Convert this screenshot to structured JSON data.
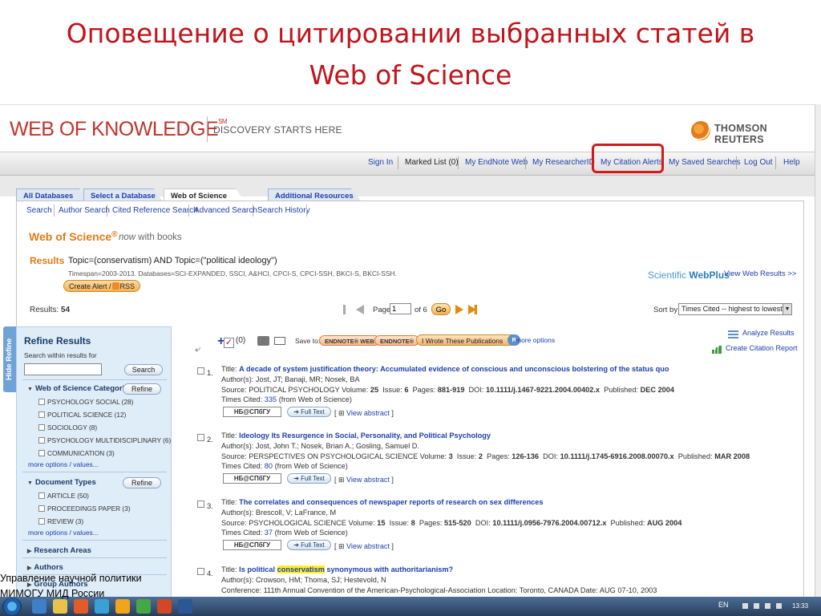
{
  "slide": {
    "title_line1": "Оповещение о цитировании выбранных статей в",
    "title_line2": "Web of Science",
    "footer_line1": "Управление научной политики",
    "footer_line2": "МИМОГУ МИД России"
  },
  "header": {
    "logo": "WEB OF KNOWLEDGE",
    "logo_sm": "SM",
    "tagline": "DISCOVERY STARTS HERE",
    "publisher": "THOMSON REUTERS"
  },
  "toplinks": [
    "Sign In",
    "Marked List (0)",
    "My EndNote Web",
    "My ResearcherID",
    "My Citation Alerts",
    "My Saved Searches",
    "Log Out",
    "Help"
  ],
  "db_tabs": [
    "All Databases",
    "Select a Database",
    "Web of Science",
    "Additional Resources"
  ],
  "subnav": [
    "Search",
    "Author Search",
    "Cited Reference Search",
    "Advanced Search",
    "Search History"
  ],
  "wos": {
    "title": "Web of Science",
    "reg": "®",
    "subtitle_now": "now",
    "subtitle_rest": " with books"
  },
  "results": {
    "label": "Results",
    "query": "Topic=(conservatism) AND Topic=(\"political ideology\")",
    "timespan": "Timespan=2003-2013. Databases=SCI-EXPANDED, SSCI, A&HCI, CPCI-S, CPCI-SSH, BKCI-S, BKCI-SSH.",
    "create_alert": "Create Alert /",
    "rss": "RSS",
    "webplus_a": "Scientific",
    "webplus_b": "WebPlus",
    "view_web": "View Web Results >>",
    "count_label": "Results:",
    "count": "54",
    "page_label": "Page",
    "page_value": "1",
    "page_of": "of 6",
    "go": "Go",
    "sort_label": "Sort by:",
    "sort_value": "Times Cited -- highest to lowest"
  },
  "refine": {
    "hide": "Hide Refine",
    "title": "Refine Results",
    "search_label": "Search within results for",
    "search_btn": "Search",
    "refine_btn": "Refine",
    "cat_title": "Web of Science Categories",
    "categories": [
      "PSYCHOLOGY SOCIAL (28)",
      "POLITICAL SCIENCE (12)",
      "SOCIOLOGY (8)",
      "PSYCHOLOGY MULTIDISCIPLINARY (6)",
      "COMMUNICATION (3)"
    ],
    "more": "more options / values...",
    "doc_title": "Document Types",
    "doc_types": [
      "ARTICLE (50)",
      "PROCEEDINGS PAPER (3)",
      "REVIEW (3)"
    ],
    "closed_sections": [
      "Research Areas",
      "Authors",
      "Group Authors"
    ]
  },
  "actions": {
    "count": "(0)",
    "save_to": "Save to:",
    "endnote_web": "ENDNOTE® WEB",
    "endnote": "ENDNOTE®",
    "iwrote": "I Wrote These Publications",
    "rid": "R",
    "more": "more options",
    "analyze": "Analyze Results",
    "ccr": "Create Citation Report"
  },
  "records": [
    {
      "num": "1.",
      "title_label": "Title:",
      "title_pre": "A decade of system justification theory: Accumulated evidence of conscious and unconscious bolstering of the status quo",
      "title_hl": "",
      "title_post": "",
      "authors": "Author(s): Jost, JT; Banaji, MR; Nosek, BA",
      "source_label": "Source: POLITICAL PSYCHOLOGY  Volume:",
      "volume": "25",
      "issue_label": "Issue:",
      "issue": "6",
      "pages_label": "Pages:",
      "pages": "881-919",
      "doi_label": "DOI:",
      "doi": "10.1111/j.1467-9221.2004.00402.x",
      "pub_label": "Published:",
      "published": "DEC 2004",
      "cited_label": "Times Cited:",
      "cited": "335",
      "cited_src": "(from Web of Science)",
      "lib": "НБ@СПбГУ",
      "fulltext": "➔ Full Text",
      "view_abstract": "View abstract"
    },
    {
      "num": "2.",
      "title_label": "Title:",
      "title_pre": "Ideology Its Resurgence in Social, Personality, and Political Psychology",
      "title_hl": "",
      "title_post": "",
      "authors": "Author(s): Jost, John T.; Nosek, Brian A.; Gosling, Samuel D.",
      "source_label": "Source: PERSPECTIVES ON PSYCHOLOGICAL SCIENCE  Volume:",
      "volume": "3",
      "issue_label": "Issue:",
      "issue": "2",
      "pages_label": "Pages:",
      "pages": "126-136",
      "doi_label": "DOI:",
      "doi": "10.1111/j.1745-6916.2008.00070.x",
      "pub_label": "Published:",
      "published": "MAR 2008",
      "cited_label": "Times Cited:",
      "cited": "80",
      "cited_src": "(from Web of Science)",
      "lib": "НБ@СПбГУ",
      "fulltext": "➔ Full Text",
      "view_abstract": "View abstract"
    },
    {
      "num": "3.",
      "title_label": "Title:",
      "title_pre": "The correlates and consequences of newspaper reports of research on sex differences",
      "title_hl": "",
      "title_post": "",
      "authors": "Author(s): Brescoll, V; LaFrance, M",
      "source_label": "Source: PSYCHOLOGICAL SCIENCE  Volume:",
      "volume": "15",
      "issue_label": "Issue:",
      "issue": "8",
      "pages_label": "Pages:",
      "pages": "515-520",
      "doi_label": "DOI:",
      "doi": "10.1111/j.0956-7976.2004.00712.x",
      "pub_label": "Published:",
      "published": "AUG 2004",
      "cited_label": "Times Cited:",
      "cited": "37",
      "cited_src": "(from Web of Science)",
      "lib": "НБ@СПбГУ",
      "fulltext": "➔ Full Text",
      "view_abstract": "View abstract"
    },
    {
      "num": "4.",
      "title_label": "Title:",
      "title_pre": "Is political ",
      "title_hl": "conservatism",
      "title_post": " synonymous with authoritarianism?",
      "authors": "Author(s): Crowson, HM; Thoma, SJ; Hestevold, N",
      "conference": "Conference: 111th Annual Convention of the American-Psychological-Association Location: Toronto, CANADA Date: AUG 07-10, 2003"
    }
  ],
  "taskbar": {
    "lang": "EN",
    "time": "13:33"
  },
  "colors": {
    "title_red": "#c0151b",
    "link_blue": "#1f3fa8",
    "wos_orange": "#e07b17",
    "highlight_box": "#d61a1a",
    "refine_bg": "#dfedf9"
  }
}
